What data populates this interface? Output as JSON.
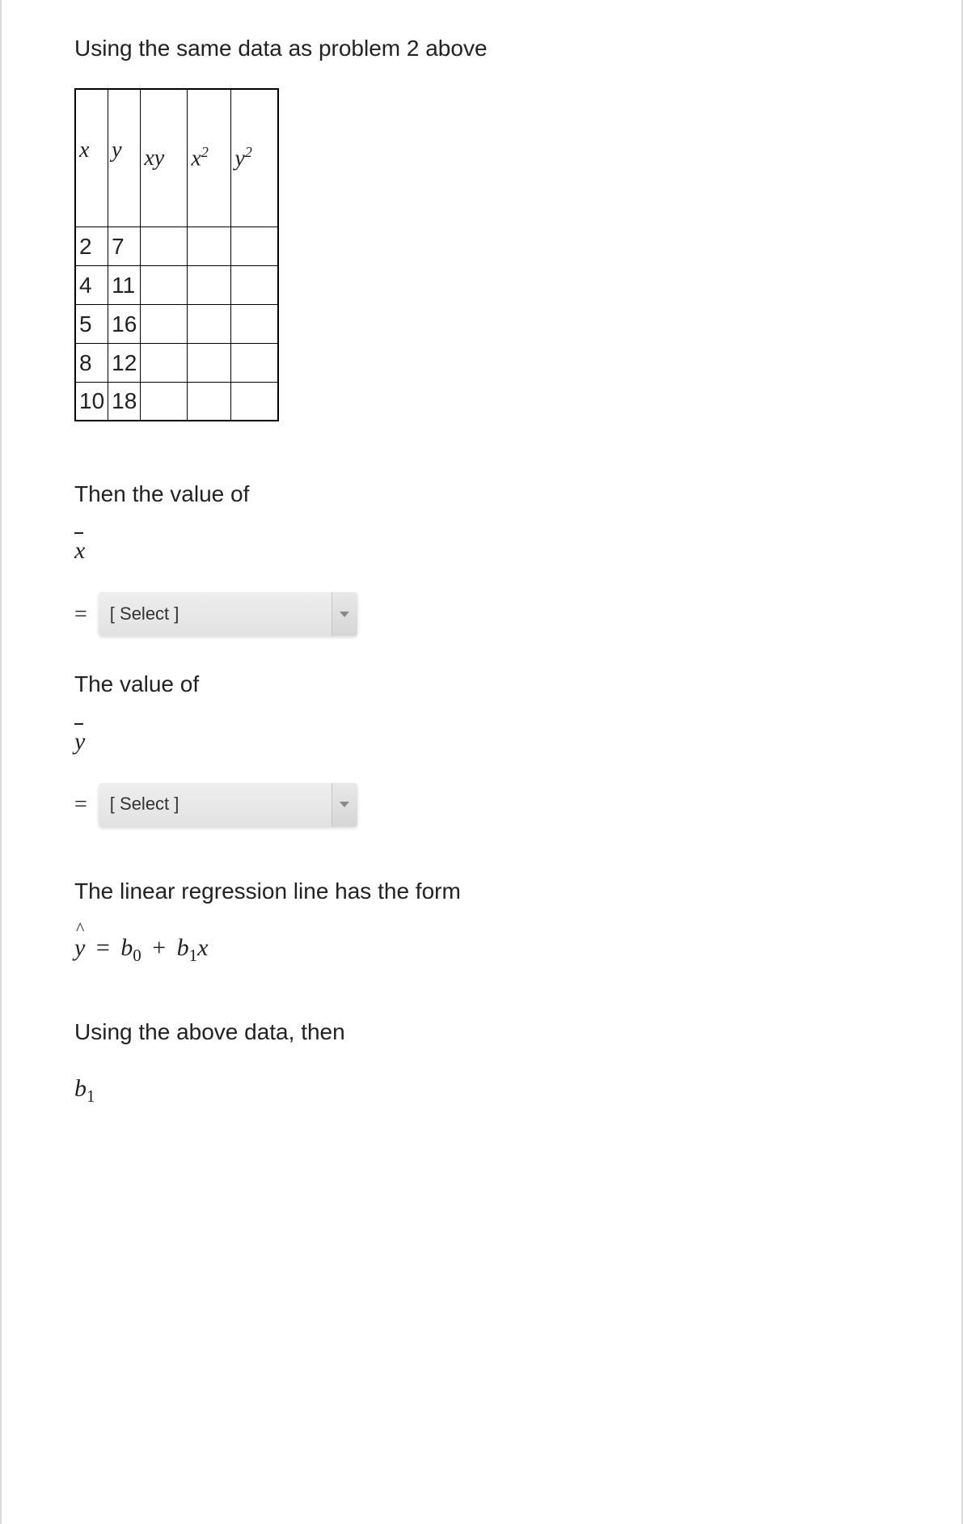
{
  "intro": "Using the same data as problem 2 above",
  "table": {
    "headers": {
      "x": "x",
      "y": "y",
      "xy": "xy",
      "x2": "x",
      "x2sup": "2",
      "y2": "y",
      "y2sup": "2"
    },
    "rows": [
      {
        "x": "2",
        "y": "7",
        "xy": "",
        "x2": "",
        "y2": ""
      },
      {
        "x": "4",
        "y": "11",
        "xy": "",
        "x2": "",
        "y2": ""
      },
      {
        "x": "5",
        "y": "16",
        "xy": "",
        "x2": "",
        "y2": ""
      },
      {
        "x": "8",
        "y": "12",
        "xy": "",
        "x2": "",
        "y2": ""
      },
      {
        "x": "10",
        "y": "18",
        "xy": "",
        "x2": "",
        "y2": ""
      }
    ]
  },
  "then_value_of": "Then the value of",
  "xbar_var": "x",
  "equals": "=",
  "select_xbar": {
    "placeholder": "[ Select ]"
  },
  "value_of": "The value of",
  "ybar_var": "y",
  "select_ybar": {
    "placeholder": "[ Select ]"
  },
  "regression_intro": "The linear regression line has the form",
  "equation": {
    "yhat": "y",
    "eq": "=",
    "b": "b",
    "sub0": "0",
    "plus": "+",
    "sub1": "1",
    "x": "x"
  },
  "using_above": "Using the above data,  then",
  "b1": {
    "b": "b",
    "sub": "1"
  }
}
